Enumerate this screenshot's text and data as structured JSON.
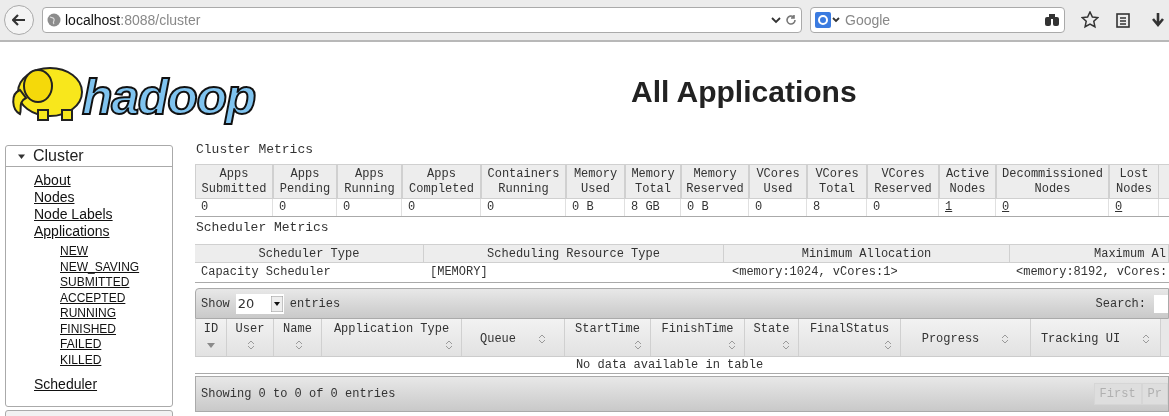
{
  "browser": {
    "url_host": "localhost",
    "url_path": ":8088/cluster",
    "search_placeholder": "Google"
  },
  "logo": {
    "text": "hadoop"
  },
  "page_title": "All Applications",
  "sidebar": {
    "title": "Cluster",
    "expanded": true,
    "items": [
      {
        "label": "About"
      },
      {
        "label": "Nodes"
      },
      {
        "label": "Node Labels"
      },
      {
        "label": "Applications",
        "children": [
          {
            "label": "NEW"
          },
          {
            "label": "NEW_SAVING"
          },
          {
            "label": "SUBMITTED"
          },
          {
            "label": "ACCEPTED"
          },
          {
            "label": "RUNNING"
          },
          {
            "label": "FINISHED"
          },
          {
            "label": "FAILED"
          },
          {
            "label": "KILLED"
          }
        ]
      },
      {
        "label": "Scheduler"
      }
    ]
  },
  "cluster_metrics": {
    "title": "Cluster Metrics",
    "columns": [
      "Apps Submitted",
      "Apps Pending",
      "Apps Running",
      "Apps Completed",
      "Containers Running",
      "Memory Used",
      "Memory Total",
      "Memory Reserved",
      "VCores Used",
      "VCores Total",
      "VCores Reserved",
      "Active Nodes",
      "Decommissioned Nodes",
      "Lost Nodes"
    ],
    "row": [
      {
        "text": "0",
        "link": false
      },
      {
        "text": "0",
        "link": false
      },
      {
        "text": "0",
        "link": false
      },
      {
        "text": "0",
        "link": false
      },
      {
        "text": "0",
        "link": false
      },
      {
        "text": "0 B",
        "link": false
      },
      {
        "text": "8 GB",
        "link": false
      },
      {
        "text": "0 B",
        "link": false
      },
      {
        "text": "0",
        "link": false
      },
      {
        "text": "8",
        "link": false
      },
      {
        "text": "0",
        "link": false
      },
      {
        "text": "1",
        "link": true
      },
      {
        "text": "0",
        "link": true
      },
      {
        "text": "0",
        "link": true
      }
    ]
  },
  "scheduler_metrics": {
    "title": "Scheduler Metrics",
    "columns": [
      "Scheduler Type",
      "Scheduling Resource Type",
      "Minimum Allocation",
      "Maximum Al"
    ],
    "row": [
      "Capacity Scheduler",
      "[MEMORY]",
      "<memory:1024, vCores:1>",
      "<memory:8192, vCores:"
    ]
  },
  "applications": {
    "show_label": "Show",
    "page_length": "20",
    "entries_label": "entries",
    "search_label": "Search:",
    "columns": [
      {
        "label": "ID",
        "sorted": true
      },
      {
        "label": "User",
        "sorted": false
      },
      {
        "label": "Name",
        "sorted": false
      },
      {
        "label": "Application Type",
        "sorted": false
      },
      {
        "label": "Queue",
        "sorted": false
      },
      {
        "label": "StartTime",
        "sorted": false
      },
      {
        "label": "FinishTime",
        "sorted": false
      },
      {
        "label": "State",
        "sorted": false
      },
      {
        "label": "FinalStatus",
        "sorted": false
      },
      {
        "label": "Progress",
        "sorted": false
      },
      {
        "label": "Tracking UI",
        "sorted": false
      }
    ],
    "empty_message": "No data available in table",
    "info": "Showing 0 to 0 of 0 entries",
    "pagination": [
      {
        "label": "First",
        "disabled": true
      },
      {
        "label": "Pr",
        "disabled": true
      }
    ]
  }
}
